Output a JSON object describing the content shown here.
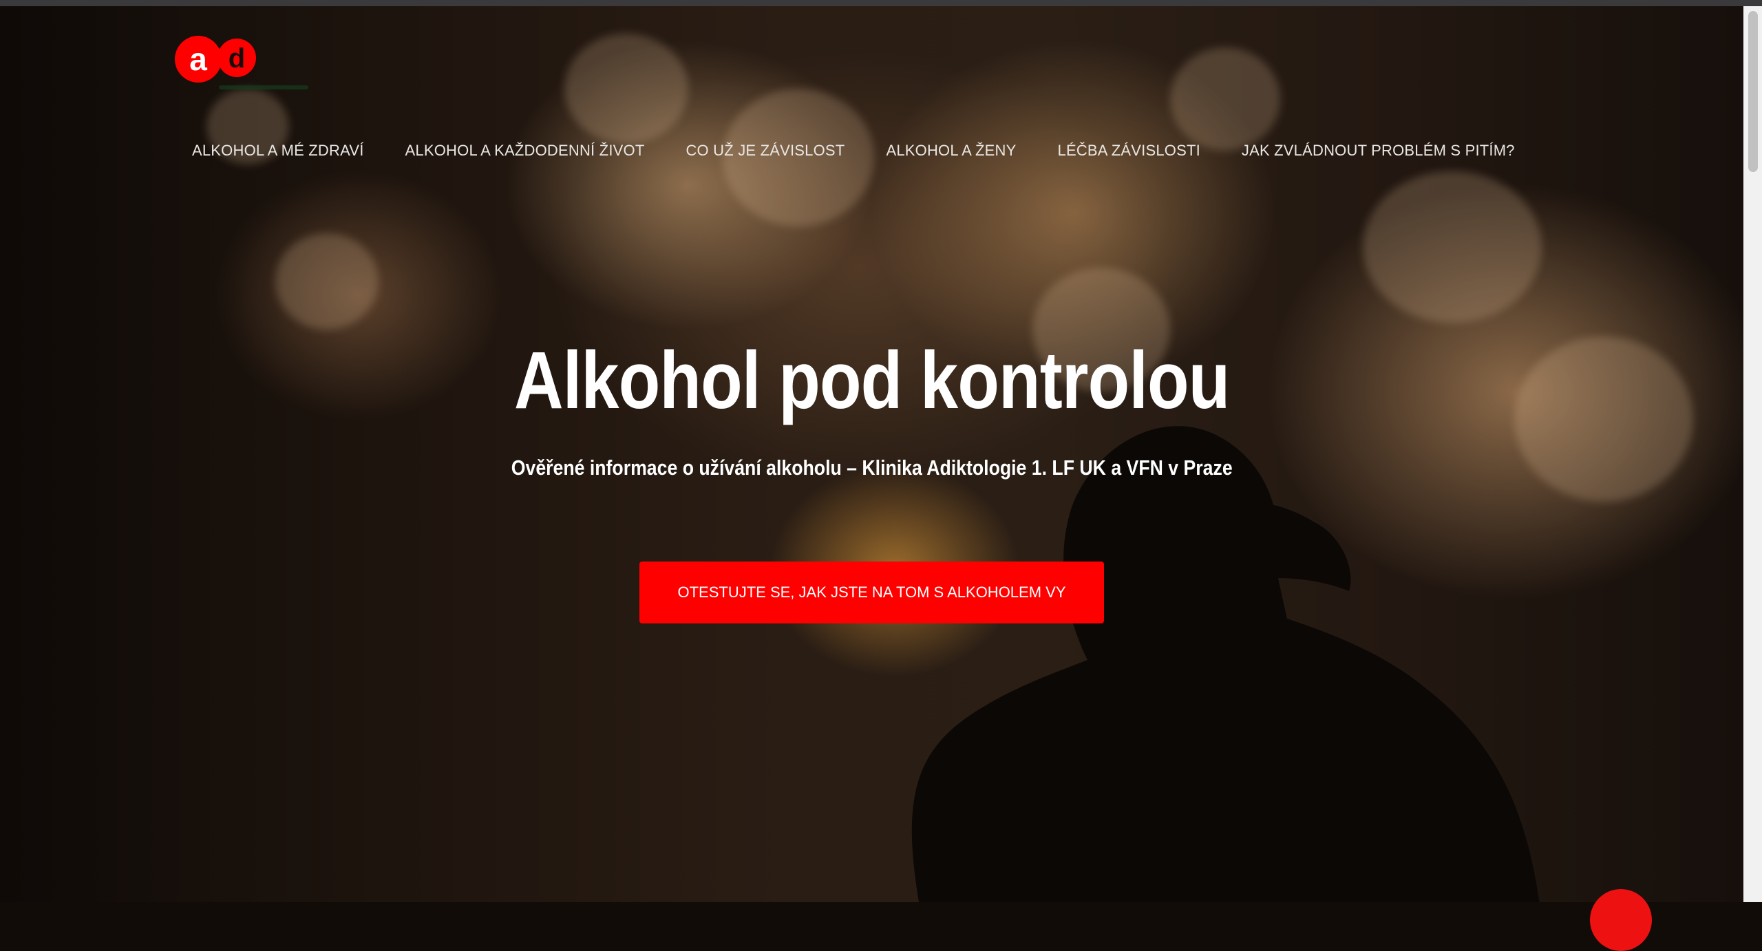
{
  "logo": {
    "letters": "ad",
    "brand_color": "#ff0000"
  },
  "nav": {
    "items": [
      "ALKOHOL A MÉ ZDRAVÍ",
      "ALKOHOL A KAŽDODENNÍ ŽIVOT",
      "CO UŽ JE ZÁVISLOST",
      "ALKOHOL A ŽENY",
      "LÉČBA ZÁVISLOSTI",
      "JAK ZVLÁDNOUT PROBLÉM S PITÍM?"
    ]
  },
  "hero": {
    "title": "Alkohol pod kontrolou",
    "subtitle": "Ověřené informace o užívání alkoholu – Klinika Adiktologie 1. LF UK a VFN v Praze",
    "cta_label": "OTESTUJTE SE, JAK JSTE NA TOM S ALKOHOLEM VY"
  },
  "colors": {
    "accent": "#ff0000",
    "text": "#ffffff"
  }
}
